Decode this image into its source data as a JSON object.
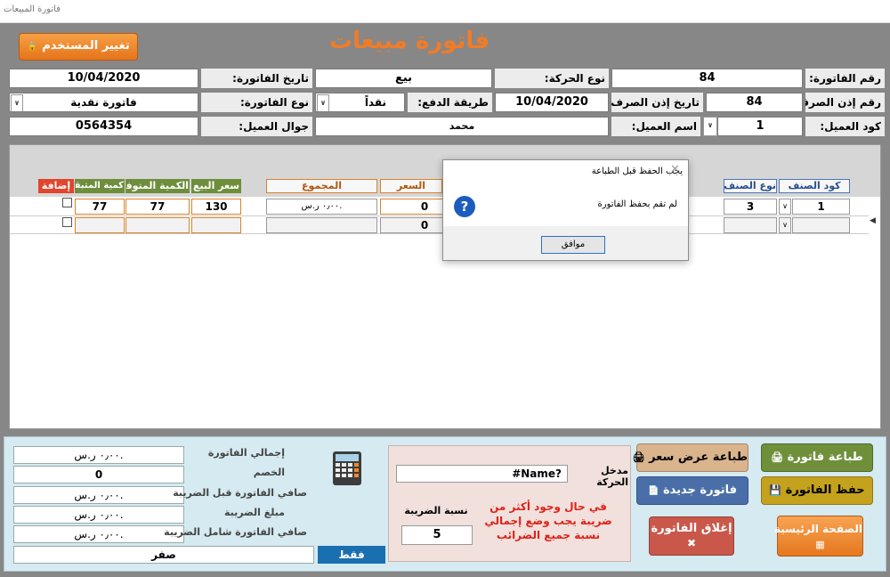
{
  "window": {
    "title": "فاتورة المبيعات"
  },
  "header": {
    "title": "فاتورة مبيعات",
    "change_user_label": "تغيير المستخدم"
  },
  "form": {
    "invoice_no_label": "رقم الفاتورة:",
    "invoice_no": "84",
    "movement_type_label": "نوع الحركة:",
    "movement_type": "بيع",
    "invoice_date_label": "تاريخ الفاتورة:",
    "invoice_date": "10/04/2020",
    "voucher_no_label": "رقم إذن الصرف:",
    "voucher_no": "84",
    "voucher_date_label": "تاريخ إذن الصرف:",
    "voucher_date": "10/04/2020",
    "payment_method_label": "طريقة الدفع:",
    "payment_method": "نقداً",
    "invoice_type_label": "نوع الفاتورة:",
    "invoice_type": "فاتورة نقدية",
    "customer_code_label": "كود العميل:",
    "customer_code": "1",
    "customer_name_label": "اسم العميل:",
    "customer_name": "محمد",
    "customer_mobile_label": "جوال العميل:",
    "customer_mobile": "0564354"
  },
  "grid": {
    "columns": {
      "code": "كود الصنف",
      "type": "نوع الصنف",
      "price": "السعر",
      "total": "المجموع",
      "sell_price": "سعر البيع",
      "available_qty": "الكمية المتوفرة",
      "remaining_qty": "كمية المتبقي",
      "add": "إضافة"
    },
    "rows": [
      {
        "code": "1",
        "type": "3",
        "price": "0",
        "total": "٠٫٠٠ ر.س.",
        "sell_price": "130",
        "available_qty": "77",
        "remaining_qty": "77"
      },
      {
        "code": "",
        "type": "",
        "price": "0",
        "total": "",
        "sell_price": "",
        "available_qty": "",
        "remaining_qty": ""
      }
    ]
  },
  "dialog": {
    "title": "يجب الحفظ قبل الطباعة",
    "message": "لم تقم بحفظ الفاتورة",
    "ok_label": "موافق",
    "icon": "question-icon"
  },
  "summary": {
    "total_label": "إجمالي الفاتورة",
    "total": "٠٫٠٠ ر.س.",
    "discount_label": "الخصم",
    "discount": "0",
    "net_before_tax_label": "صافي الفاتورة قبل الضريبة",
    "net_before_tax": "٠٫٠٠ ر.س.",
    "tax_amount_label": "مبلغ الضريبة",
    "tax_amount": "٠٫٠٠ ر.س.",
    "net_with_tax_label": "صافي الفاتورة شامل الضريبة",
    "net_with_tax": "٠٫٠٠ ر.س.",
    "only_label": "فقط",
    "amount_words": "صفر"
  },
  "movement": {
    "entered_by_label": "مدخل الحركة",
    "entered_by": "#Name?",
    "tax_rate_label": "نسبة الضريبة",
    "tax_rate": "5",
    "note": "في حال وجود أكثر من ضريبة يجب وضع إجمالي نسبة جميع الضرائب"
  },
  "actions": {
    "print_invoice": "طباعة فاتورة",
    "print_quote": "طباعة عرض سعر",
    "save_invoice": "حفظ الفاتورة",
    "new_invoice": "فاتورة جديدة",
    "close_invoice": "إغلاق الفاتورة",
    "home": "الصفحة الرئيسية"
  },
  "colors": {
    "orange": "#f08a2a",
    "green": "#6f8f3b",
    "olive": "#c4a21d",
    "blue": "#4a6fa8",
    "red": "#c9584b",
    "header_text": "#f07c28"
  }
}
